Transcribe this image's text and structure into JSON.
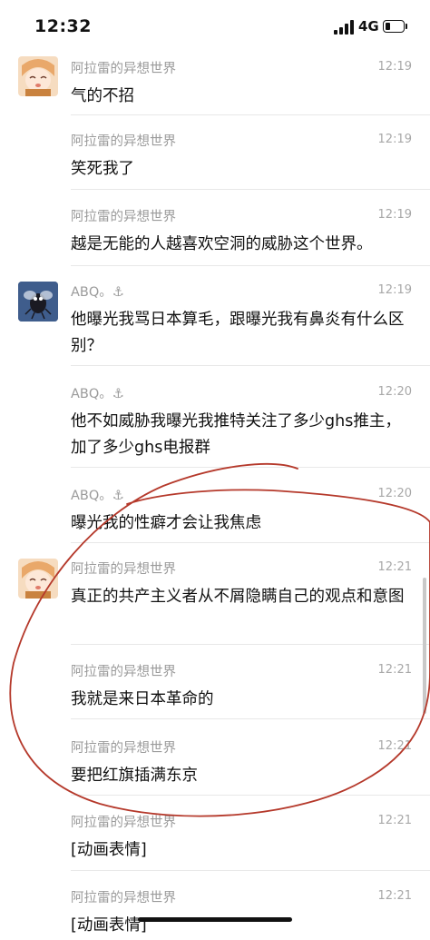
{
  "status_bar": {
    "time": "12:32",
    "network": "4G",
    "battery_level": 0.25
  },
  "messages": [
    {
      "sender": "阿拉雷的异想世界",
      "time": "12:19",
      "text": "气的不招",
      "avatar": "arale-avatar"
    },
    {
      "sender": "阿拉雷的异想世界",
      "time": "12:19",
      "text": "笑死我了"
    },
    {
      "sender": "阿拉雷的异想世界",
      "time": "12:19",
      "text": "越是无能的人越喜欢空洞的威胁这个世界。"
    },
    {
      "sender": "ABQ。⚓",
      "time": "12:19",
      "text": "他曝光我骂日本算毛，跟曝光我有鼻炎有什么区别？",
      "avatar": "abq-avatar"
    },
    {
      "sender": "ABQ。⚓",
      "time": "12:20",
      "text": "他不如威胁我曝光我推特关注了多少ghs推主，加了多少ghs电报群"
    },
    {
      "sender": "ABQ。⚓",
      "time": "12:20",
      "text": "曝光我的性癖才会让我焦虑"
    },
    {
      "sender": "阿拉雷的异想世界",
      "time": "12:21",
      "text": "真正的共产主义者从不屑隐瞒自己的观点和意图",
      "avatar": "arale-avatar"
    },
    {
      "sender": "阿拉雷的异想世界",
      "time": "12:21",
      "text": "我就是来日本革命的"
    },
    {
      "sender": "阿拉雷的异想世界",
      "time": "12:21",
      "text": "要把红旗插满东京"
    },
    {
      "sender": "阿拉雷的异想世界",
      "time": "12:21",
      "text": "[动画表情]"
    },
    {
      "sender": "阿拉雷的异想世界",
      "time": "12:21",
      "text": "[动画表情]"
    }
  ],
  "colors": {
    "annotation_red": "#b5392b",
    "meta_gray": "#9b9b9b",
    "background": "#ffffff"
  }
}
